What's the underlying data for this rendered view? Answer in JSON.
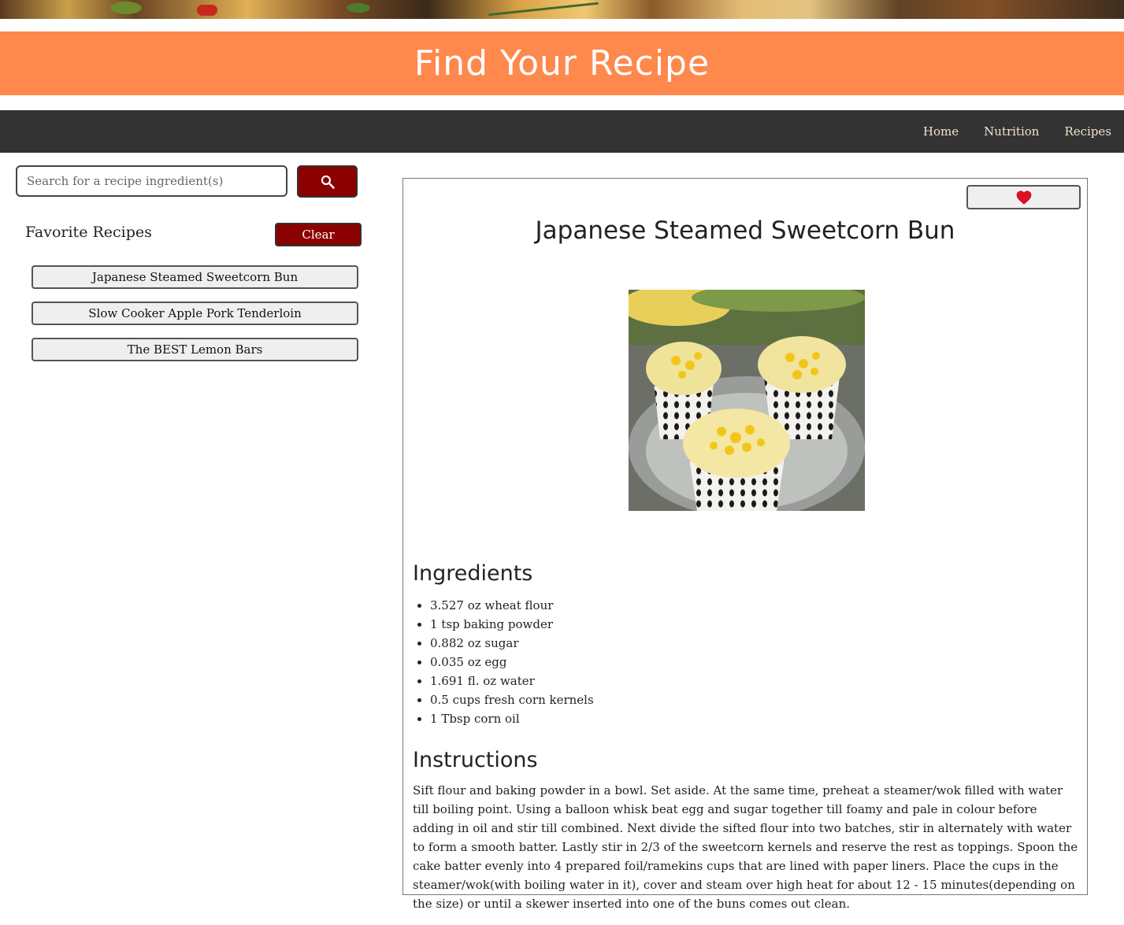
{
  "header": {
    "title": "Find Your Recipe"
  },
  "nav": {
    "links": [
      "Home",
      "Nutrition",
      "Recipes"
    ]
  },
  "search": {
    "placeholder": "Search for a recipe ingredient(s)",
    "icon": "search-icon"
  },
  "favorites": {
    "title": "Favorite Recipes",
    "clear_label": "Clear",
    "items": [
      "Japanese Steamed Sweetcorn Bun",
      "Slow Cooker Apple Pork Tenderloin",
      "The BEST Lemon Bars"
    ]
  },
  "recipe": {
    "favorite_icon": "heart-icon",
    "title": "Japanese Steamed Sweetcorn Bun",
    "ingredients_heading": "Ingredients",
    "ingredients": [
      "3.527 oz wheat flour",
      "1 tsp baking powder",
      "0.882 oz sugar",
      "0.035 oz egg",
      "1.691 fl. oz water",
      "0.5 cups fresh corn kernels",
      "1 Tbsp corn oil"
    ],
    "instructions_heading": "Instructions",
    "instructions": "Sift flour and baking powder in a bowl. Set aside. At the same time, preheat a steamer/wok filled with water till boiling point. Using a balloon whisk beat egg and sugar together till foamy and pale in colour before adding in oil and stir till combined. Next divide the sifted flour into two batches, stir in alternately with water to form a smooth batter. Lastly stir in 2/3 of the sweetcorn kernels and reserve the rest as toppings. Spoon the cake batter evenly into 4 prepared foil/ramekins cups that are lined with paper liners. Place the cups in the steamer/wok(with boiling water in it), cover and steam over high heat for about 12 - 15 minutes(depending on the size) or until a skewer inserted into one of the buns comes out clean."
  },
  "colors": {
    "header_bg": "#ff884d",
    "nav_bg": "#333333",
    "button_accent": "#8b0000",
    "heart": "#e0101e"
  }
}
